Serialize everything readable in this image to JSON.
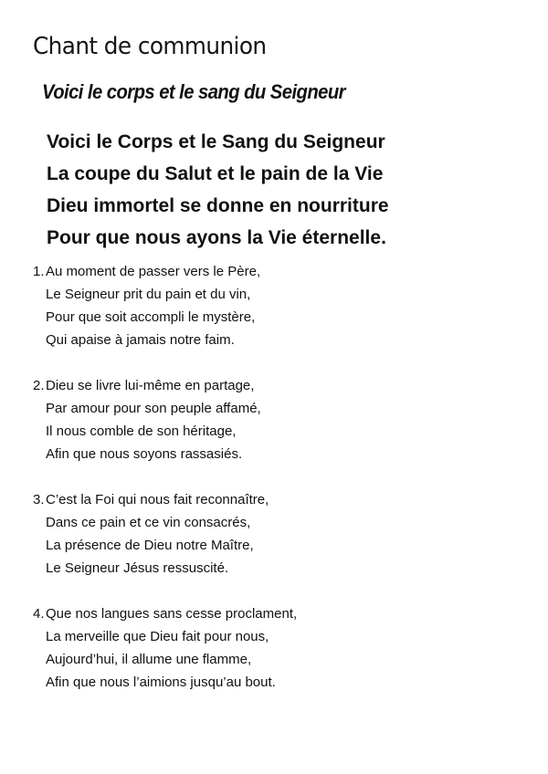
{
  "heading": "Chant de communion",
  "song_title": "Voici le corps et le sang du Seigneur",
  "refrain": [
    "Voici le Corps et le Sang du Seigneur",
    "La coupe du Salut et le pain de la Vie",
    "Dieu immortel se donne en nourriture",
    "Pour que nous ayons la Vie éternelle."
  ],
  "verses": [
    {
      "number": "1.",
      "lines": [
        "Au moment de passer vers le Père,",
        "Le Seigneur prit du pain et du vin,",
        "Pour que soit accompli le mystère,",
        "Qui apaise à jamais notre faim."
      ]
    },
    {
      "number": "2.",
      "lines": [
        "Dieu se livre lui-même en partage,",
        "Par amour pour son peuple affamé,",
        "Il nous comble de son héritage,",
        "Afin que nous soyons rassasiés."
      ]
    },
    {
      "number": "3.",
      "lines": [
        "C’est la Foi qui nous fait reconnaître,",
        "Dans ce pain et ce vin consacrés,",
        "La présence de Dieu notre Maître,",
        "Le Seigneur Jésus ressuscité."
      ]
    },
    {
      "number": "4.",
      "lines": [
        "Que nos langues sans cesse proclament,",
        "La merveille que Dieu fait pour nous,",
        "Aujourd’hui, il allume une flamme,",
        "Afin que nous l’aimions jusqu’au bout."
      ]
    }
  ]
}
